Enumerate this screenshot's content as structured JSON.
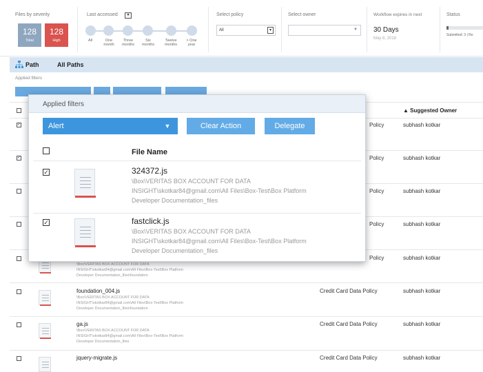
{
  "filters": {
    "severity_label": "Files by severity",
    "total_count": "128",
    "total_label": "Total",
    "high_count": "128",
    "high_label": "High",
    "last_accessed_label": "Last accessed",
    "last_accessed_ticks": [
      "All",
      "One month",
      "Three months",
      "Six months",
      "Twelve months",
      "> One year"
    ],
    "select_policy_label": "Select policy",
    "select_policy_value": "All",
    "select_owner_label": "Select owner",
    "workflow_label": "Workflow expires in next",
    "workflow_days": "30 Days",
    "workflow_date": "May 8, 2018",
    "status_label": "Status",
    "status_sub": "Submitted: 3 | Re"
  },
  "pathbar": {
    "path_label": "Path",
    "all_paths": "All Paths"
  },
  "applied_filters_small": "Applied filters",
  "background_table": {
    "suggested_owner_header": "Suggested Owner",
    "rows": [
      {
        "policy": "Policy",
        "owner": "subhash kotkar"
      },
      {
        "policy": "Policy",
        "owner": "subhash kotkar"
      },
      {
        "policy": "Policy",
        "owner": "subhash kotkar"
      },
      {
        "policy": "Policy",
        "owner": "subhash kotkar"
      },
      {
        "policy": "Policy",
        "owner": "subhash kotkar"
      },
      {
        "name": "foundation_004.js",
        "path": [
          "\\Box\\VERITAS BOX ACCOUNT FOR DATA",
          "INSIGHT\\skotkar84@gmail.com\\All Files\\Box-Test\\Box Platform",
          "Developer Documentation_files\\foundation"
        ],
        "policy": "Credit Card Data Policy",
        "owner": "subhash kotkar"
      },
      {
        "name": "ga.js",
        "path": [
          "\\Box\\VERITAS BOX ACCOUNT FOR DATA",
          "INSIGHT\\skotkar84@gmail.com\\All Files\\Box-Test\\Box Platform",
          "Developer Documentation_files"
        ],
        "policy": "Credit Card Data Policy",
        "owner": "subhash kotkar"
      },
      {
        "name": "jquery-migrate.js",
        "policy": "Credit Card Data Policy",
        "owner": "subhash kotkar"
      }
    ],
    "partial_path": [
      "\\Box\\VERITAS BOX ACCOUNT FOR DATA",
      "INSIGHT\\skotkar84@gmail.com\\All Files\\Box-Test\\Box Platform",
      "Developer Documentation_files\\foundation"
    ]
  },
  "panel": {
    "title": "Applied filters",
    "alert_value": "Alert",
    "clear_action": "Clear Action",
    "delegate": "Delegate",
    "file_name_header": "File Name",
    "files": [
      {
        "name": "324372.js",
        "path": [
          "\\Box\\VERITAS BOX ACCOUNT FOR DATA",
          "INSIGHT\\skotkar84@gmail.com\\All Files\\Box-Test\\Box Platform",
          "Developer Documentation_files"
        ]
      },
      {
        "name": "fastclick.js",
        "path": [
          "\\Box\\VERITAS BOX ACCOUNT FOR DATA",
          "INSIGHT\\skotkar84@gmail.com\\All Files\\Box-Test\\Box Platform",
          "Developer Documentation_files"
        ]
      }
    ]
  },
  "colors": {
    "high": "#d9534f",
    "total": "#8fa6bf",
    "accent_blue": "#3d96dd",
    "button_blue": "#62abe6"
  }
}
